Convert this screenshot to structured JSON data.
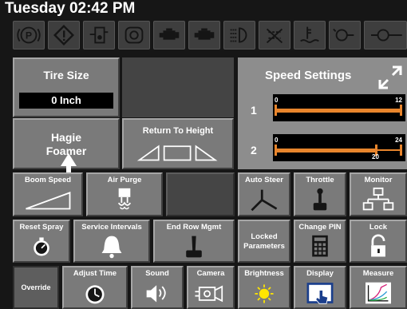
{
  "status_bar": {
    "datetime": "Tuesday 02:42 PM"
  },
  "warning_icons": [
    {
      "name": "parking-brake-icon",
      "glyph": "(P)"
    },
    {
      "name": "warning-triangle-icon",
      "glyph": "!"
    },
    {
      "name": "fuel-water-icon",
      "glyph": ""
    },
    {
      "name": "engine-temp-icon",
      "glyph": ""
    },
    {
      "name": "engine-icon",
      "glyph": ""
    },
    {
      "name": "engine-check-icon",
      "glyph": ""
    },
    {
      "name": "light-icon",
      "glyph": ""
    },
    {
      "name": "fan-off-icon",
      "glyph": ""
    },
    {
      "name": "coolant-icon",
      "glyph": ""
    },
    {
      "name": "oil-can-icon",
      "glyph": ""
    },
    {
      "name": "oil-pressure-icon",
      "glyph": ""
    }
  ],
  "tire_size": {
    "label": "Tire Size",
    "value": "0 Inch"
  },
  "hagie_foamer": {
    "label": "Hagie Foamer"
  },
  "return_to_height": {
    "label": "Return To Height"
  },
  "speed_settings": {
    "title": "Speed Settings",
    "rows": [
      {
        "number": "1",
        "min": "0",
        "max": "12",
        "value": 12
      },
      {
        "number": "2",
        "min": "0",
        "max": "24",
        "value": 20,
        "value_label": "20"
      }
    ]
  },
  "buttons": {
    "boom_speed": "Boom Speed",
    "air_purge": "Air Purge",
    "auto_steer": "Auto Steer",
    "throttle": "Throttle",
    "monitor": "Monitor",
    "reset_spray": "Reset Spray",
    "service_intervals": "Service Intervals",
    "end_row_mgmt": "End Row Mgmt",
    "locked_parameters": "Locked Parameters",
    "change_pin": "Change PIN",
    "lock": "Lock",
    "override": "Override",
    "adjust_time": "Adjust Time",
    "sound": "Sound",
    "camera": "Camera",
    "brightness": "Brightness",
    "display": "Display",
    "measure": "Measure"
  },
  "colors": {
    "accent_orange": "#e8852c",
    "button_gray": "#7a7a7a",
    "bezel": "#161616"
  }
}
